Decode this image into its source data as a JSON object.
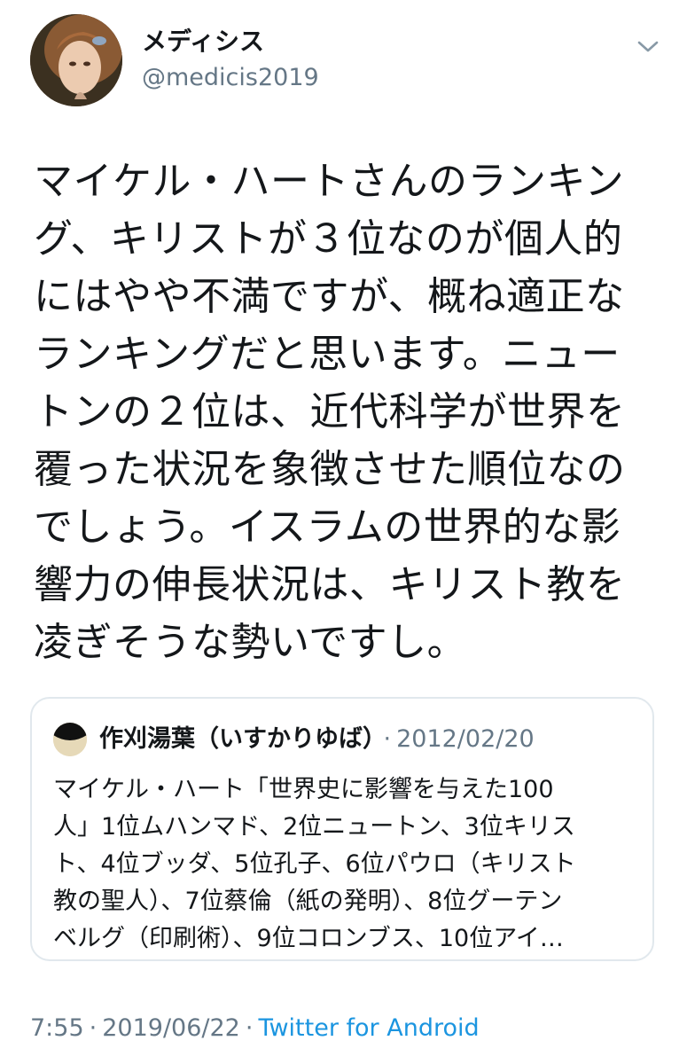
{
  "author": {
    "name": "メディシス",
    "handle": "@medicis2019"
  },
  "tweet": {
    "lines": [
      "マイケル・ハートさんのランキン",
      "グ、キリストが３位なのが個人的",
      "にはやや不満ですが、概ね適正な",
      "ランキングだと思います。ニュー",
      "トンの２位は、近代科学が世界を",
      "覆った状況を象徴させた順位なの",
      "でしょう。イスラムの世界的な影",
      "響力の伸長状況は、キリスト教を",
      "凌ぎそうな勢いですし。"
    ]
  },
  "quoted_tweet": {
    "author_name": "作刈湯葉（いすかりゆば）",
    "separator": "·",
    "date": "2012/02/20",
    "lines": [
      "マイケル・ハート「世界史に影響を与えた100",
      "人」1位ムハンマド、2位ニュートン、3位キリス",
      "ト、4位ブッダ、5位孔子、6位パウロ（キリスト",
      "教の聖人）、7位蔡倫（紙の発明）、8位グーテン",
      "ベルグ（印刷術）、9位コロンブス、10位アイ…"
    ]
  },
  "meta": {
    "time": "7:55",
    "separator_1": "·",
    "date": "2019/06/22",
    "separator_2": "·",
    "source": "Twitter for Android"
  },
  "icons": {
    "menu": "chevron-down-icon",
    "avatar": "portrait-painting",
    "quote_avatar": "half-moon-black-cream"
  },
  "colors": {
    "text": "#14171a",
    "secondary": "#657786",
    "link": "#1b95e0",
    "border": "#e1e8ed"
  }
}
